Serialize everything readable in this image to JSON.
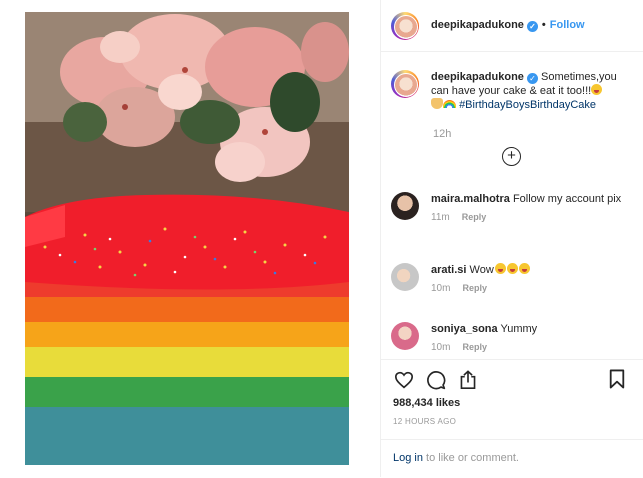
{
  "header": {
    "username": "deepikapadukone",
    "separator": "•",
    "follow_label": "Follow"
  },
  "caption": {
    "username": "deepikapadukone",
    "text": "Sometimes,you can have your cake & eat it too!!!",
    "hashtag": "#BirthdayBoysBirthdayCake",
    "time": "12h",
    "load_more_icon": "+"
  },
  "comments": [
    {
      "username": "maira.malhotra",
      "text": "Follow my account pix",
      "time": "11m",
      "reply": "Reply"
    },
    {
      "username": "arati.si",
      "text": "Wow",
      "time": "10m",
      "reply": "Reply"
    },
    {
      "username": "soniya_sona",
      "text": "Yummy",
      "time": "10m",
      "reply": "Reply"
    }
  ],
  "actions": {
    "icons": [
      "heart-icon",
      "comment-icon",
      "share-icon",
      "bookmark-icon"
    ],
    "likes": "988,434 likes",
    "timestamp": "12 HOURS AGO"
  },
  "login": {
    "link": "Log in",
    "rest": " to like or comment."
  },
  "colors": {
    "link_blue": "#3897f0",
    "hashtag": "#003569",
    "muted": "#999999"
  }
}
